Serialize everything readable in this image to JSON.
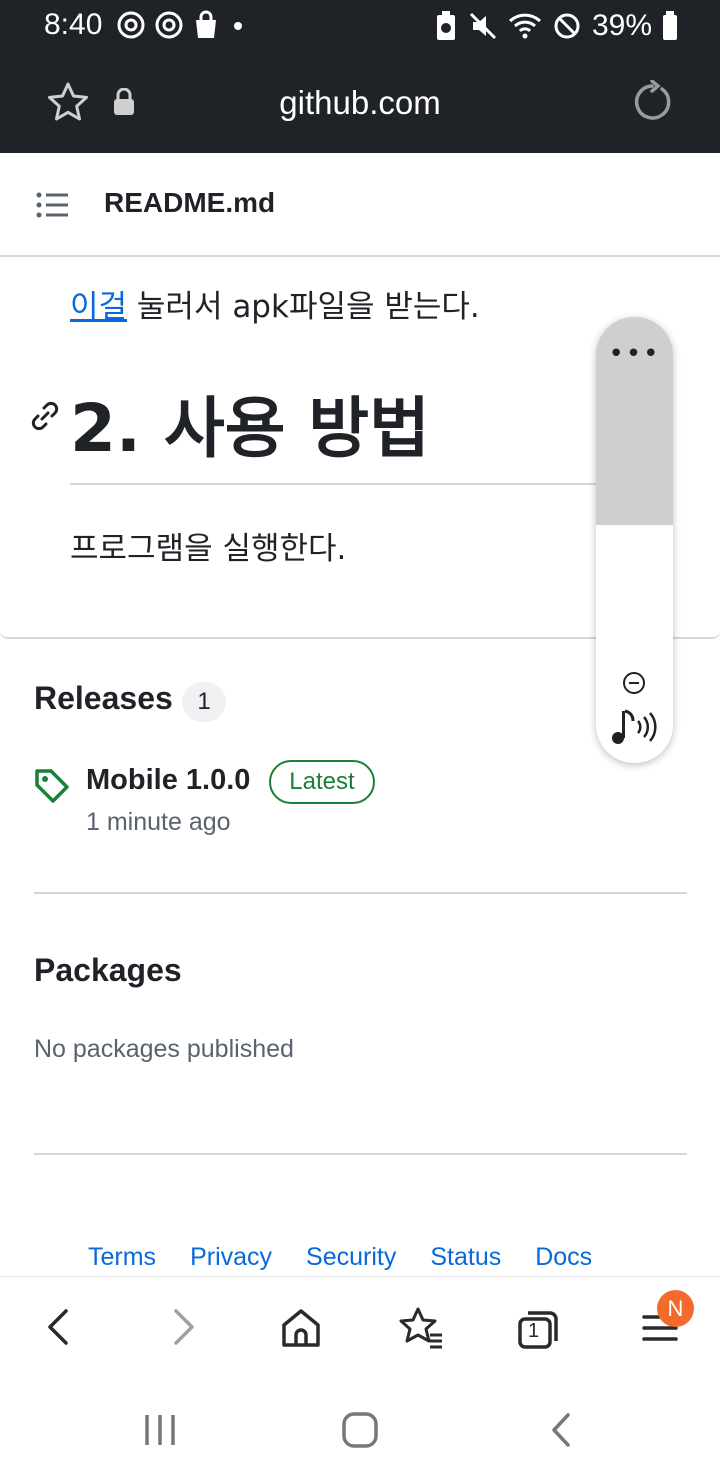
{
  "status_bar": {
    "time": "8:40",
    "battery": "39%"
  },
  "url_bar": {
    "domain": "github.com"
  },
  "readme": {
    "file_name": "README.md",
    "download_link": "이걸",
    "download_rest": " 눌러서 apk파일을 받는다.",
    "heading": "2. 사용 방법",
    "paragraph": "프로그램을 실행한다."
  },
  "floating_panel": {
    "dots": "•••"
  },
  "releases": {
    "title": "Releases",
    "count": "1",
    "item": {
      "name": "Mobile 1.0.0",
      "badge": "Latest",
      "time": "1 minute ago"
    }
  },
  "packages": {
    "title": "Packages",
    "empty_text": "No packages published"
  },
  "footer": {
    "links": [
      "Terms",
      "Privacy",
      "Security",
      "Status",
      "Docs"
    ]
  },
  "browser_nav": {
    "tabs_count": "1",
    "menu_badge": "N"
  },
  "colors": {
    "link": "#0969da",
    "latest_green": "#1a7f37",
    "badge_orange": "#f26a2c",
    "top_bar": "#1f2327"
  }
}
